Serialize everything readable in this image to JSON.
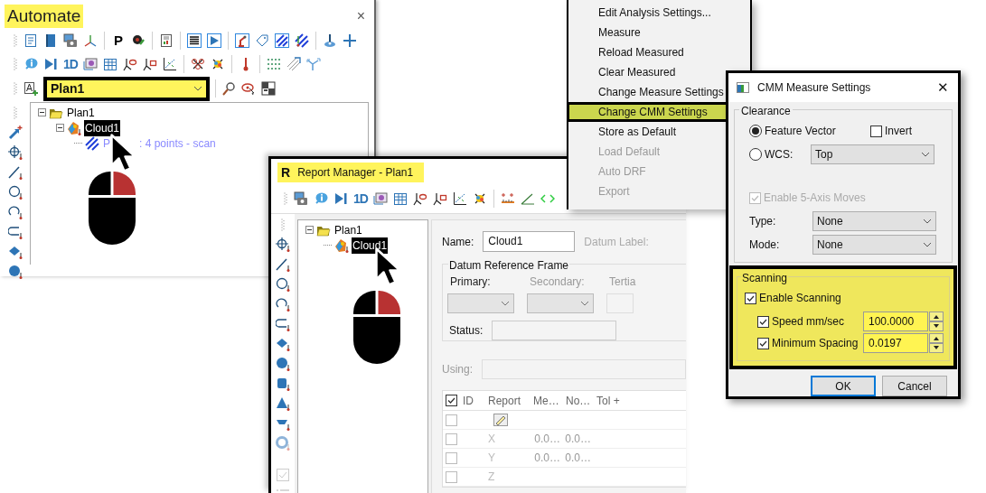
{
  "automate": {
    "title": "Automate",
    "close": "×",
    "toolbar_labels": [
      "P",
      "1D"
    ],
    "plan_combo": {
      "value": "Plan1"
    },
    "tree": [
      {
        "label": "Plan1",
        "selected": false,
        "expanded": true,
        "children": [
          {
            "label": "Cloud1",
            "selected": true,
            "expanded": true,
            "children": [
              {
                "label_parts": [
                  "P",
                  ": 4 points - scan"
                ],
                "selected": false
              }
            ]
          }
        ]
      }
    ]
  },
  "report_manager": {
    "icon_letter": "R",
    "title": "Report Manager - Plan1",
    "toolbar_labels": [
      "1D"
    ],
    "tree": [
      {
        "label": "Plan1",
        "selected": false,
        "expanded": true,
        "children": [
          {
            "label": "Cloud1",
            "selected": true
          }
        ]
      }
    ],
    "name_label": "Name:",
    "name_value": "Cloud1",
    "datum_label": "Datum Label:",
    "drf": {
      "title": "Datum Reference Frame",
      "labels": [
        "Primary:",
        "Secondary:",
        "Tertia"
      ]
    },
    "status_label": "Status:",
    "using_label": "Using:",
    "table": {
      "header_checked": true,
      "columns": [
        "ID",
        "Report",
        "Me…",
        "No…",
        "Tol +"
      ],
      "rows": [
        {
          "kind": "edit",
          "checked": false
        },
        {
          "kind": "value",
          "checked": false,
          "report": "X",
          "cells": [
            "0.0…",
            "0.0…"
          ]
        },
        {
          "kind": "value",
          "checked": false,
          "report": "Y",
          "cells": [
            "0.0…",
            "0.0…"
          ]
        },
        {
          "kind": "value",
          "checked": false,
          "report": "Z"
        }
      ]
    }
  },
  "menu": {
    "items": [
      {
        "label": "Edit Analysis Settings...",
        "selected": false,
        "disabled": false
      },
      {
        "label": "Measure",
        "selected": false,
        "disabled": false
      },
      {
        "label": "Reload Measured",
        "selected": false,
        "disabled": false
      },
      {
        "label": "Clear Measured",
        "selected": false,
        "disabled": false
      },
      {
        "label": "Change Measure Settings",
        "selected": false,
        "disabled": false
      },
      {
        "label": "Change CMM Settings",
        "selected": true,
        "disabled": false
      },
      {
        "label": "Store as Default",
        "selected": false,
        "disabled": false
      },
      {
        "label": "Load Default",
        "selected": false,
        "disabled": true
      },
      {
        "label": "Auto DRF",
        "selected": false,
        "disabled": true
      },
      {
        "label": "Export",
        "selected": false,
        "disabled": true
      }
    ]
  },
  "cmm_dialog": {
    "title": "CMM Measure Settings",
    "close": "✕",
    "clearance": {
      "title": "Clearance",
      "feature_vector": {
        "label": "Feature Vector",
        "selected": true
      },
      "invert": {
        "label": "Invert",
        "checked": false
      },
      "wcs": {
        "label": "WCS:",
        "selected": false,
        "value": "Top"
      },
      "five_axis": {
        "label": "Enable 5-Axis Moves",
        "checked": true
      },
      "type": {
        "label": "Type:",
        "value": "None"
      },
      "mode": {
        "label": "Mode:",
        "value": "None"
      }
    },
    "scanning": {
      "title": "Scanning",
      "enable": {
        "label": "Enable Scanning",
        "checked": true
      },
      "speed": {
        "label": "Speed mm/sec",
        "checked": true,
        "value": "100.0000"
      },
      "spacing": {
        "label": "Minimum Spacing",
        "checked": true,
        "value": "0.0197"
      }
    },
    "buttons": [
      {
        "label": "OK",
        "selected": true
      },
      {
        "label": "Cancel",
        "selected": false
      }
    ]
  }
}
